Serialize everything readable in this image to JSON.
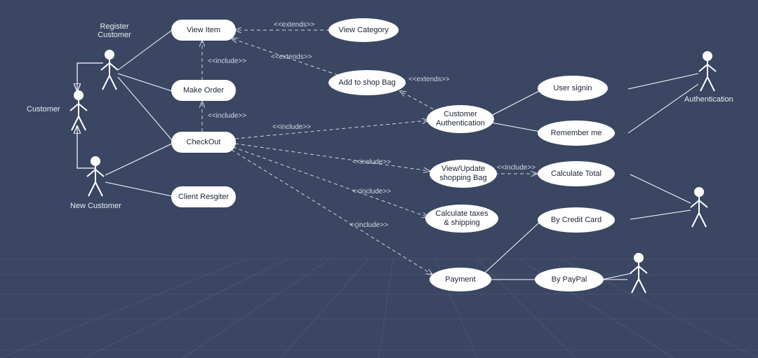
{
  "diagram": {
    "type": "uml-use-case",
    "background": "#3a4662",
    "node_fill": "#ffffff",
    "actors": {
      "register_customer": {
        "label": "Register\nCustomer"
      },
      "customer": {
        "label": "Customer"
      },
      "new_customer": {
        "label": "New Customer"
      },
      "authentication": {
        "label": "Authentication"
      },
      "payment_actor_1": {
        "label": ""
      },
      "payment_actor_2": {
        "label": ""
      }
    },
    "usecases": {
      "view_item": {
        "label": "View Item"
      },
      "make_order": {
        "label": "Make Order"
      },
      "checkout": {
        "label": "CheckOut"
      },
      "client_register": {
        "label": "Client Resgiter"
      },
      "view_category": {
        "label": "View Category"
      },
      "add_to_bag": {
        "label": "Add to shop Bag"
      },
      "cust_auth": {
        "label": "Customer\nAuthentication"
      },
      "user_signin": {
        "label": "User signin"
      },
      "remember_me": {
        "label": "Remember me"
      },
      "view_update_bag": {
        "label": "View/Update\nshopping Bag"
      },
      "calc_total": {
        "label": "Calculate Total"
      },
      "calc_tax_ship": {
        "label": "Calculate taxes\n& shipping"
      },
      "by_credit_card": {
        "label": "By Credit Card"
      },
      "payment": {
        "label": "Payment"
      },
      "by_paypal": {
        "label": "By PayPal"
      }
    },
    "rel_labels": {
      "ext1": "<<extends>>",
      "ext2": "<<extends>>",
      "ext3": "<<extends>>",
      "inc1": "<<include>>",
      "inc2": "<<include>>",
      "inc3": "<<include>>",
      "inc4": "<<include>>",
      "inc5": "<<include>>",
      "inc6": "<<include>>",
      "inc7": "<<include>>"
    }
  },
  "chart_data": {
    "type": "uml-use-case",
    "actors": [
      "Register Customer",
      "Customer",
      "New Customer",
      "Authentication",
      "(payment actor 1)",
      "(payment actor 2)"
    ],
    "use_cases": [
      "View Item",
      "Make Order",
      "CheckOut",
      "Client Resgiter",
      "View Category",
      "Add to shop Bag",
      "Customer Authentication",
      "User signin",
      "Remember me",
      "View/Update shopping Bag",
      "Calculate Total",
      "Calculate taxes & shipping",
      "By Credit Card",
      "Payment",
      "By PayPal"
    ],
    "associations": [
      [
        "Register Customer",
        "View Item"
      ],
      [
        "Register Customer",
        "Make Order"
      ],
      [
        "Register Customer",
        "CheckOut"
      ],
      [
        "New Customer",
        "CheckOut"
      ],
      [
        "New Customer",
        "Client Resgiter"
      ],
      [
        "Authentication",
        "User signin"
      ],
      [
        "Authentication",
        "Remember me"
      ],
      [
        "(payment actor 1)",
        "By Credit Card"
      ],
      [
        "(payment actor 1)",
        "Calculate Total"
      ],
      [
        "(payment actor 2)",
        "By PayPal"
      ],
      [
        "(payment actor 2)",
        "Payment"
      ]
    ],
    "generalizations": [
      [
        "Register Customer",
        "Customer"
      ],
      [
        "New Customer",
        "Customer"
      ]
    ],
    "includes": [
      [
        "Make Order",
        "View Item"
      ],
      [
        "CheckOut",
        "Make Order"
      ],
      [
        "CheckOut",
        "Customer Authentication"
      ],
      [
        "CheckOut",
        "View/Update shopping Bag"
      ],
      [
        "CheckOut",
        "Calculate taxes & shipping"
      ],
      [
        "CheckOut",
        "Payment"
      ],
      [
        "View/Update shopping Bag",
        "Calculate Total"
      ]
    ],
    "extends": [
      [
        "View Category",
        "View Item"
      ],
      [
        "Add to shop Bag",
        "View Item"
      ],
      [
        "Customer Authentication",
        "Add to shop Bag"
      ]
    ],
    "use_case_links": [
      [
        "Customer Authentication",
        "User signin"
      ],
      [
        "Customer Authentication",
        "Remember me"
      ],
      [
        "Payment",
        "By Credit Card"
      ],
      [
        "Payment",
        "By PayPal"
      ]
    ]
  }
}
